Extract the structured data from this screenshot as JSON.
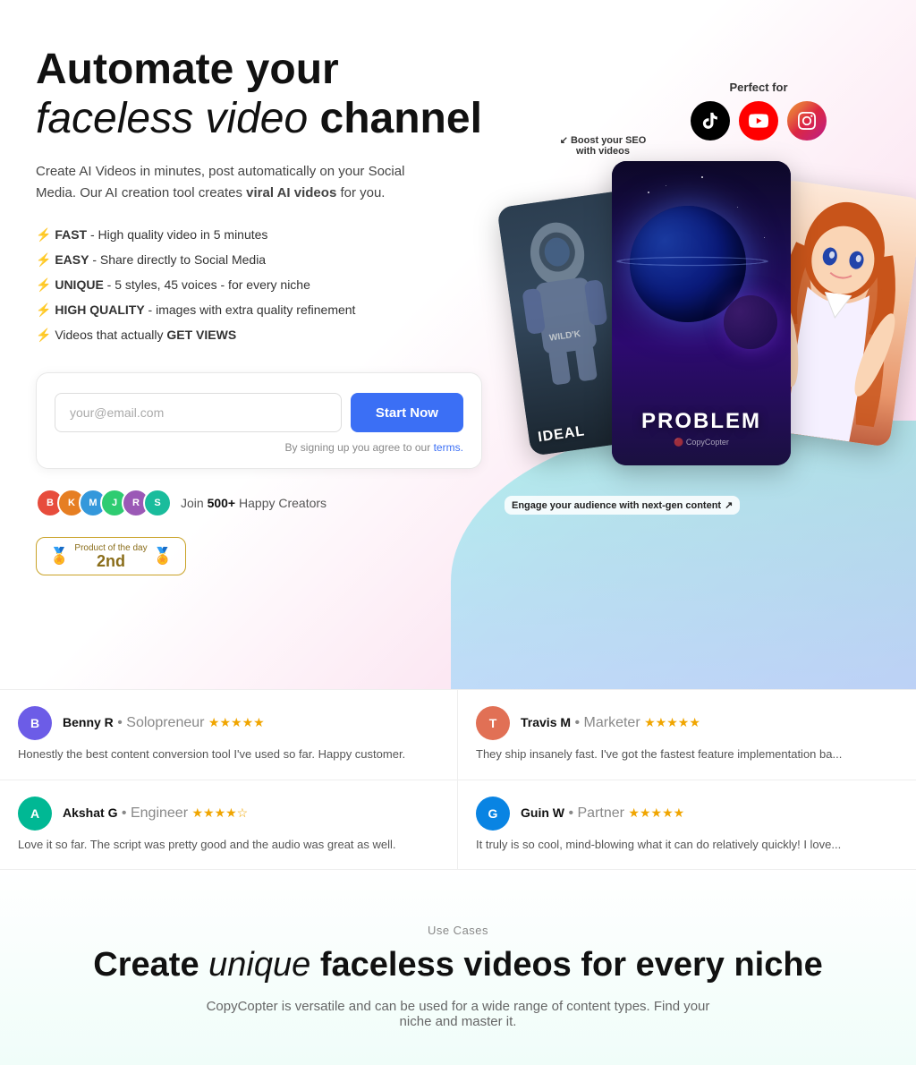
{
  "hero": {
    "title_line1": "Automate your",
    "title_line2": "faceless video",
    "title_line3": "channel",
    "description": "Create AI Videos in minutes, post automatically on your Social Media. Our AI creation tool creates",
    "description_highlight": "viral AI videos",
    "description_end": "for you.",
    "features": [
      {
        "bold": "FAST",
        "text": " - High quality video in 5 minutes"
      },
      {
        "bold": "EASY",
        "text": " - Share directly to Social Media"
      },
      {
        "bold": "UNIQUE",
        "text": " - 5 styles, 45 voices - for every niche"
      },
      {
        "bold": "HIGH QUALITY",
        "text": " - images with extra quality refinement"
      },
      {
        "bold": "GET VIEWS",
        "text_before": "Videos that actually ",
        "text": ""
      }
    ]
  },
  "signup": {
    "email_placeholder": "your@email.com",
    "button_label": "Start Now",
    "terms_text": "By signing up you agree to our",
    "terms_link": "terms."
  },
  "social_proof": {
    "count": "500+",
    "label": "Happy Creators",
    "join_text": "Join"
  },
  "product_badge": {
    "label": "Product of the day",
    "rank": "2nd"
  },
  "perfect_for": {
    "label": "Perfect for"
  },
  "cards": {
    "main_label": "PROBLEM",
    "left_label": "IDEAL",
    "watermark": "🔴 CopyCopter"
  },
  "callouts": {
    "seo": "Boost your SEO with videos",
    "engage": "Engage your audience with next-gen content"
  },
  "reviews": [
    {
      "name": "Benny R",
      "role": "Solopreneur",
      "stars": "★★★★★",
      "text": "Honestly the best content conversion tool I've used so far. Happy customer.",
      "avatar_letter": "B",
      "avatar_class": "av1"
    },
    {
      "name": "Travis M",
      "role": "Marketer",
      "stars": "★★★★★",
      "text": "They ship insanely fast. I've got the fastest feature implementation ba...",
      "avatar_letter": "T",
      "avatar_class": "av2"
    },
    {
      "name": "Akshat G",
      "role": "Engineer",
      "stars": "★★★★☆",
      "text": "Love it so far. The script was pretty good and the audio was great as well.",
      "avatar_letter": "A",
      "avatar_class": "av3"
    },
    {
      "name": "Guin W",
      "role": "Partner",
      "stars": "★★★★★",
      "text": "It truly is so cool, mind-blowing what it can do relatively quickly! I love...",
      "avatar_letter": "G",
      "avatar_class": "av4"
    }
  ],
  "use_cases": {
    "label": "Use Cases",
    "title_bold1": "Create",
    "title_italic": "unique",
    "title_bold2": "faceless videos for every niche",
    "description": "CopyCopter is versatile and can be used for a wide range of content types. Find your niche and master it."
  }
}
